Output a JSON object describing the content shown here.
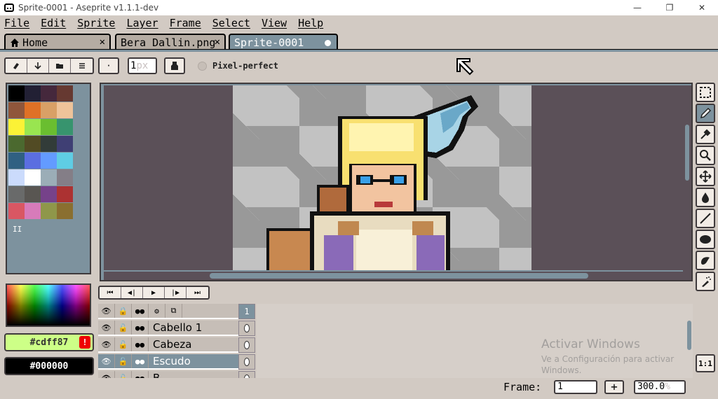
{
  "window": {
    "title": "Sprite-0001 - Aseprite v1.1.1-dev",
    "minimize": "—",
    "maximize": "❐",
    "close": "✕"
  },
  "menu": [
    "File",
    "Edit",
    "Sprite",
    "Layer",
    "Frame",
    "Select",
    "View",
    "Help"
  ],
  "tabs": [
    {
      "label": "Home",
      "close": "✕",
      "icon": "home-icon"
    },
    {
      "label": "Bera Dallin.png",
      "close": "✕"
    },
    {
      "label": "Sprite-0001",
      "active": true
    }
  ],
  "toolbar": {
    "brush_type_icons": [
      "eraser-icon",
      "down-arrow-icon",
      "folder-icon",
      "list-icon"
    ],
    "brush_shape": "·",
    "brush_size": "1",
    "brush_size_unit": "px",
    "ink_icon": "ink-bucket-icon",
    "pixel_perfect_label": "Pixel-perfect"
  },
  "palette": {
    "colors": [
      "#000000",
      "#222034",
      "#45283c",
      "#663931",
      "#8f563b",
      "#df7126",
      "#d9a066",
      "#eec39a",
      "#fbf236",
      "#99e550",
      "#6abe30",
      "#37946e",
      "#4b692f",
      "#524b24",
      "#323c39",
      "#3f3f74",
      "#306082",
      "#5b6ee1",
      "#639bff",
      "#5fcde4",
      "#cbdbfc",
      "#ffffff",
      "#9badb7",
      "#847e87",
      "#696a6a",
      "#595652",
      "#76428a",
      "#ac3232",
      "#d95763",
      "#d77bba",
      "#8f974a",
      "#8a6f30"
    ],
    "marker": "II"
  },
  "colors": {
    "foreground": "#cdff87",
    "foreground_label": "#cdff87",
    "background": "#000000",
    "background_label": "#000000",
    "warning": "!"
  },
  "timeline": {
    "controls": [
      "⏮",
      "◀|",
      "▶",
      "|▶",
      "⏭"
    ],
    "header_icons": [
      "eye-icon",
      "lock-icon",
      "continuous-icon",
      "gear-icon",
      "onion-skin-icon"
    ],
    "frame_number": "1",
    "layers": [
      {
        "name": "Cabello 1",
        "selected": false
      },
      {
        "name": "Cabeza",
        "selected": false
      },
      {
        "name": "Escudo",
        "selected": true
      },
      {
        "name": "B...",
        "selected": false
      }
    ]
  },
  "tools": [
    "rectangular-marquee-icon",
    "pencil-icon",
    "eyedropper-icon",
    "zoom-icon",
    "move-icon",
    "paint-bucket-icon",
    "line-icon",
    "ellipse-icon",
    "blur-icon",
    "spray-icon"
  ],
  "zoom_one": "1:1",
  "watermark": {
    "line1": "Activar Windows",
    "line2": "Ve a Configuración para activar",
    "line3": "Windows."
  },
  "status": {
    "frame_label": "Frame:",
    "frame_value": "1",
    "add_frame": "+",
    "zoom_value": "300.0",
    "zoom_unit": "%"
  }
}
